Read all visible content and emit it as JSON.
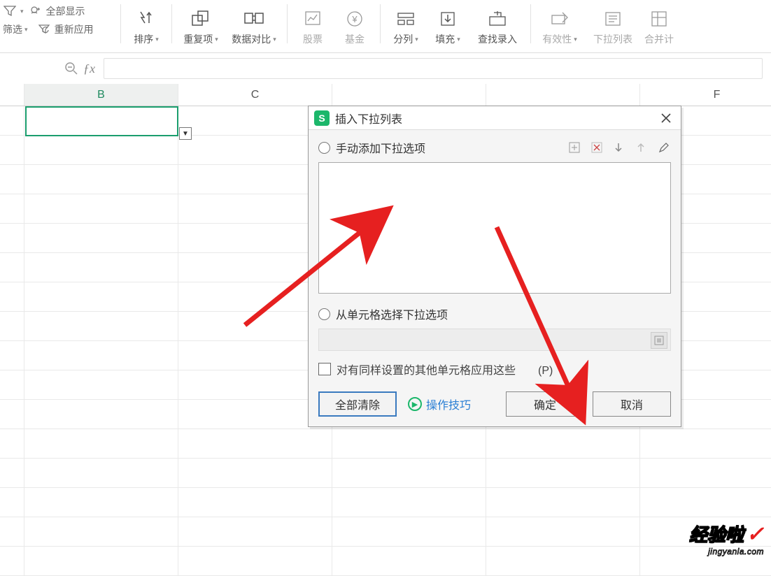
{
  "ribbon": {
    "left": {
      "filter": "筛选",
      "show_all": "全部显示",
      "reapply": "重新应用"
    },
    "sort": "排序",
    "dup": "重复项",
    "compare": "数据对比",
    "stock": "股票",
    "fund": "基金",
    "split": "分列",
    "fill": "填充",
    "find_entry": "查找录入",
    "validity": "有效性",
    "dropdown": "下拉列表",
    "merge": "合并计"
  },
  "columns": {
    "B": "B",
    "C": "C",
    "F": "F"
  },
  "dialog": {
    "title": "插入下拉列表",
    "opt_manual": "手动添加下拉选项",
    "opt_cell": "从单元格选择下拉选项",
    "chk_apply": "对有同样设置的其他单元格应用这些",
    "chk_suffix": "(P)",
    "clear": "全部清除",
    "tips": "操作技巧",
    "ok": "确定",
    "cancel": "取消"
  },
  "watermark": {
    "brand": "经验啦",
    "url": "jingyanla.com"
  }
}
